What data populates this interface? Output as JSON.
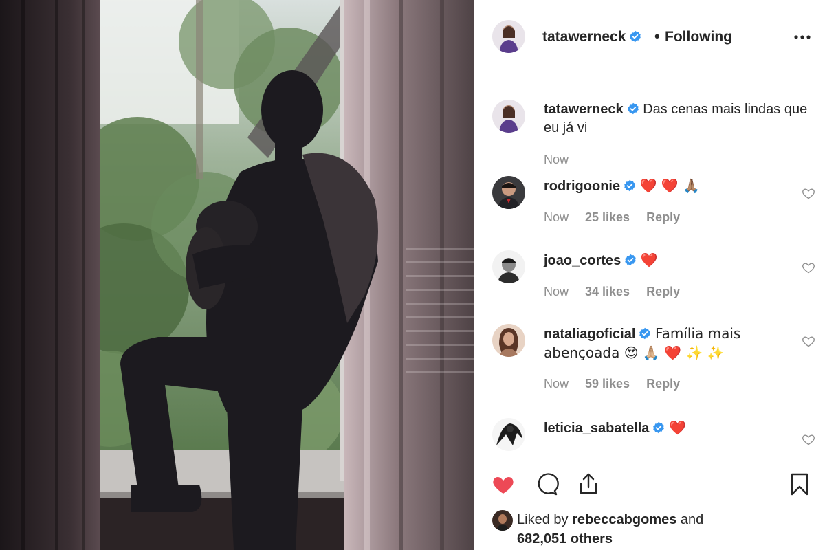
{
  "post": {
    "author": "tatawerneck",
    "following_label": "Following",
    "dot": "•"
  },
  "caption": {
    "username": "tatawerneck",
    "text": "Das cenas mais lindas que eu já vi",
    "time": "Now"
  },
  "comments": [
    {
      "username": "rodrigoonie",
      "text": "❤️ ❤️ 🙏🏽",
      "time": "Now",
      "likes": "25 likes",
      "reply": "Reply"
    },
    {
      "username": "joao_cortes",
      "text": "❤️",
      "time": "Now",
      "likes": "34 likes",
      "reply": "Reply"
    },
    {
      "username": "nataliagoficial",
      "text": "Família mais abençoada 😍 🙏🏼 ❤️ ✨ ✨",
      "time": "Now",
      "likes": "59 likes",
      "reply": "Reply"
    },
    {
      "username": "leticia_sabatella",
      "text": "❤️"
    }
  ],
  "liked_by": {
    "prefix": "Liked by",
    "user": "rebeccabgomes",
    "and": "and",
    "others": "682,051 others"
  },
  "icons": {
    "like": "heart-filled-icon",
    "comment": "comment-bubble-icon",
    "share": "share-icon",
    "save": "bookmark-icon",
    "more": "more-dots-icon",
    "verified": "verified-badge-icon"
  },
  "colors": {
    "like_red": "#ed4956",
    "verified_blue": "#3897f0",
    "secondary_text": "#8e8e8e",
    "primary_text": "#262626"
  }
}
